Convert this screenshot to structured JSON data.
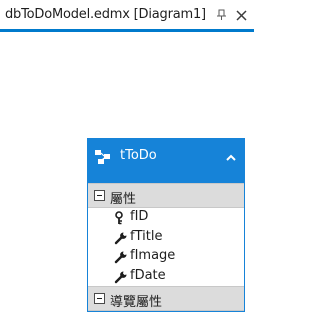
{
  "document_tab": {
    "title": "dbToDoModel.edmx [Diagram1]",
    "pin_icon": "pin-icon",
    "close_icon": "close-icon",
    "accent_color": "#007acc"
  },
  "entity": {
    "name": "tToDo",
    "icon": "entity-icon",
    "header_color": "#1683d8",
    "collapse_icon": "chevron-up-icon",
    "properties_section": {
      "label": "屬性",
      "items": [
        {
          "name": "fID",
          "icon": "key-icon"
        },
        {
          "name": "fTitle",
          "icon": "wrench-icon"
        },
        {
          "name": "fImage",
          "icon": "wrench-icon"
        },
        {
          "name": "fDate",
          "icon": "wrench-icon"
        }
      ]
    },
    "navigation_section": {
      "label": "導覽屬性"
    }
  }
}
